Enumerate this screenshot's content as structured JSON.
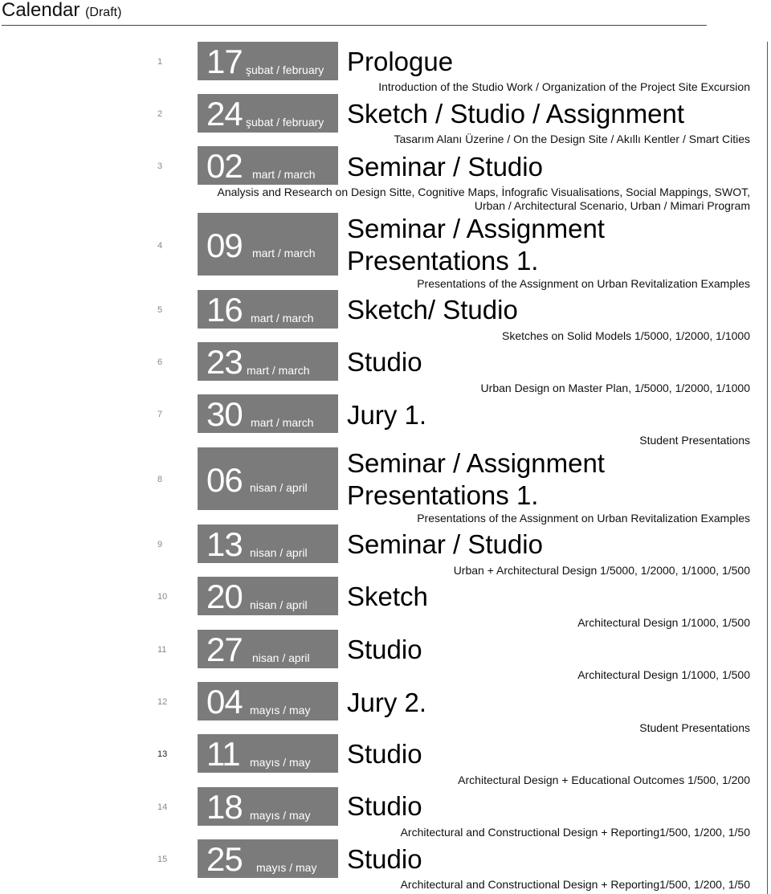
{
  "page": {
    "title": "Calendar",
    "title_suffix": "(Draft)"
  },
  "weeks": [
    {
      "num": "1",
      "day": "17",
      "month": "şubat / february",
      "heading": "Prologue",
      "description": "Introduction of the Studio Work / Organization of the Project Site Excursion"
    },
    {
      "num": "2",
      "day": "24",
      "month": "şubat / february",
      "heading": "Sketch / Studio / Assignment",
      "description": "Tasarım Alanı Üzerine / On the Design Site / Akıllı Kentler / Smart Cities"
    },
    {
      "num": "3",
      "day": "02",
      "month": "mart / march",
      "heading": "Seminar / Studio",
      "description": "Analysis and Research on Design Sitte, Cognitive Maps, İnfografic Visualisations, Social Mappings, SWOT,",
      "description2": "Urban / Architectural Scenario, Urban / Mimari Program"
    },
    {
      "num": "4",
      "day": "09",
      "month": "mart / march",
      "heading": "Seminar / Assignment",
      "heading2": "Presentations 1.",
      "description": "Presentations of the Assignment on Urban Revitalization Examples"
    },
    {
      "num": "5",
      "day": "16",
      "month": "mart / march",
      "heading": "Sketch/ Studio",
      "description": "Sketches on Solid Models 1/5000, 1/2000, 1/1000"
    },
    {
      "num": "6",
      "day": "23",
      "month": "mart / march",
      "heading": "Studio",
      "description": "Urban Design on Master Plan, 1/5000, 1/2000, 1/1000"
    },
    {
      "num": "7",
      "day": "30",
      "month": "mart / march",
      "heading": "Jury 1.",
      "description": "Student Presentations"
    },
    {
      "num": "8",
      "day": "06",
      "month": "nisan / april",
      "heading": "Seminar / Assignment",
      "heading2": "Presentations 1.",
      "description": "Presentations of the Assignment on Urban Revitalization Examples"
    },
    {
      "num": "9",
      "day": "13",
      "month": "nisan / april",
      "heading": "Seminar / Studio",
      "description": "Urban + Architectural Design 1/5000, 1/2000, 1/1000, 1/500"
    },
    {
      "num": "10",
      "day": "20",
      "month": "nisan / april",
      "heading": "Sketch",
      "description": "Architectural Design 1/1000, 1/500"
    },
    {
      "num": "11",
      "day": "27",
      "month": "nisan / april",
      "heading": "Studio",
      "description": "Architectural Design 1/1000, 1/500"
    },
    {
      "num": "12",
      "day": "04",
      "month": "mayıs / may",
      "heading": "Jury 2.",
      "description": "Student Presentations"
    },
    {
      "num": "13",
      "day": "11",
      "month": "mayıs / may",
      "heading": "Studio",
      "description": "Architectural Design + Educational Outcomes 1/500, 1/200"
    },
    {
      "num": "14",
      "day": "18",
      "month": "mayıs / may",
      "heading": "Studio",
      "description": "Architectural and Constructional Design + Reporting1/500, 1/200, 1/50"
    },
    {
      "num": "15",
      "day": "25",
      "month": "mayıs / may",
      "heading": "Studio",
      "description": "Architectural and Constructional Design + Reporting1/500, 1/200, 1/50"
    }
  ]
}
